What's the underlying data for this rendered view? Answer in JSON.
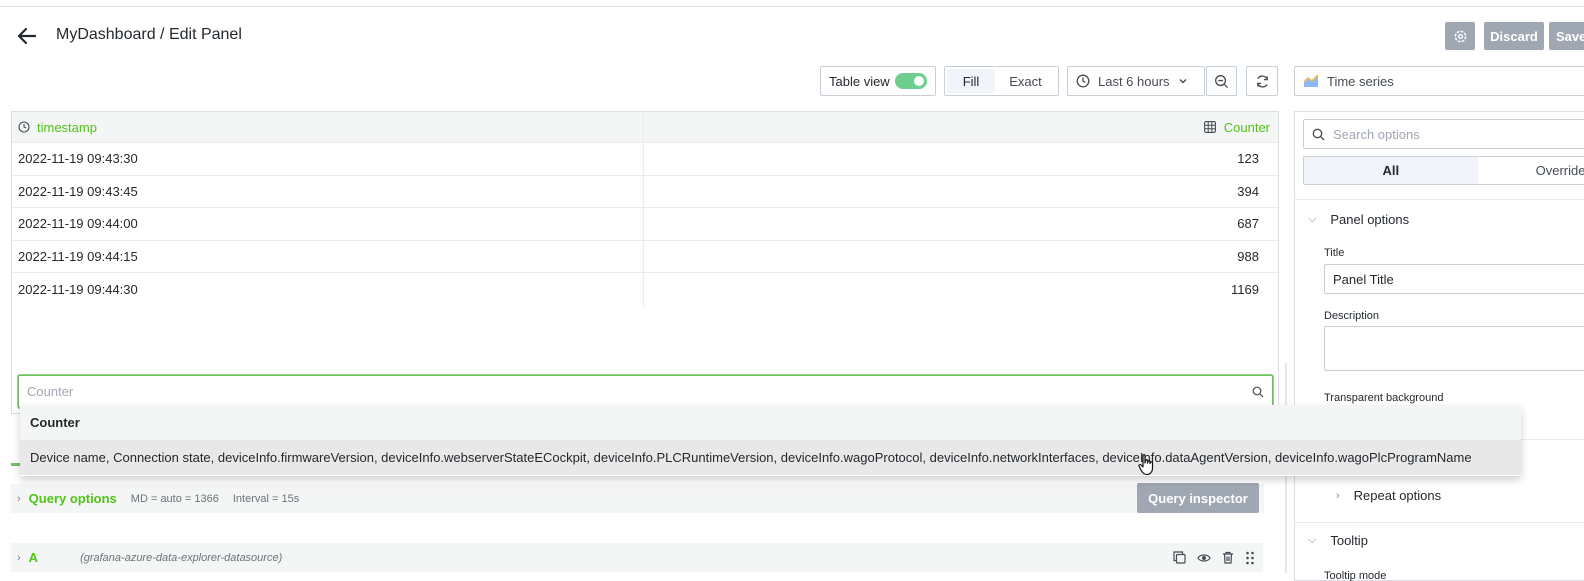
{
  "header": {
    "title": "MyDashboard / Edit Panel",
    "discard_label": "Discard",
    "save_label": "Save"
  },
  "toolbar": {
    "table_view_label": "Table view",
    "table_view_on": true,
    "fill_label": "Fill",
    "exact_label": "Exact",
    "time_range_label": "Last 6 hours",
    "visualization_label": "Time series"
  },
  "table": {
    "columns": [
      "timestamp",
      "Counter"
    ],
    "rows": [
      [
        "2022-11-19 09:43:30",
        "123"
      ],
      [
        "2022-11-19 09:43:45",
        "394"
      ],
      [
        "2022-11-19 09:44:00",
        "687"
      ],
      [
        "2022-11-19 09:44:15",
        "988"
      ],
      [
        "2022-11-19 09:44:30",
        "1169"
      ]
    ]
  },
  "field_picker": {
    "placeholder": "Counter",
    "options": [
      "Counter",
      "Device name, Connection state, deviceInfo.firmwareVersion, deviceInfo.webserverStateECockpit, deviceInfo.PLCRuntimeVersion, deviceInfo.wagoProtocol, deviceInfo.networkInterfaces, deviceInfo.dataAgentVersion, deviceInfo.wagoPlcProgramName"
    ]
  },
  "query_options": {
    "label": "Query options",
    "md": "MD = auto = 1366",
    "interval": "Interval = 15s",
    "inspector_label": "Query inspector"
  },
  "query": {
    "letter": "A",
    "datasource": "(grafana-azure-data-explorer-datasource)"
  },
  "options_pane": {
    "search_placeholder": "Search options",
    "tab_all": "All",
    "tab_overrides": "Overrides",
    "panel_options_label": "Panel options",
    "title_label": "Title",
    "title_value": "Panel Title",
    "description_label": "Description",
    "transparent_label": "Transparent background",
    "repeat_options_label": "Repeat options",
    "tooltip_label": "Tooltip",
    "tooltip_mode_label": "Tooltip mode"
  },
  "colors": {
    "accent_green": "#52c41a",
    "toggle_green": "#6ccf8e",
    "button_gray": "#9fa7b3"
  }
}
